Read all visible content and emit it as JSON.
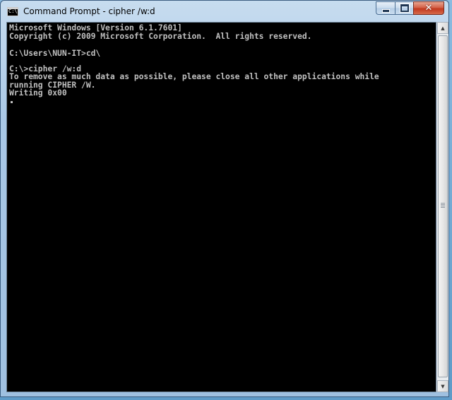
{
  "window": {
    "title": "Command Prompt - cipher  /w:d",
    "icon": "command-prompt-icon",
    "icon_text": "C:\\"
  },
  "controls": {
    "minimize": "minimize-icon",
    "maximize": "maximize-icon",
    "close": "close-icon",
    "close_glyph": "✕"
  },
  "console": {
    "lines": [
      "Microsoft Windows [Version 6.1.7601]",
      "Copyright (c) 2009 Microsoft Corporation.  All rights reserved.",
      "",
      "C:\\Users\\NUN-IT>cd\\",
      "",
      "C:\\>cipher /w:d",
      "To remove as much data as possible, please close all other applications while",
      "running CIPHER /W.",
      "Writing 0x00"
    ],
    "text_color": "#c0c0c0",
    "background": "#000000"
  },
  "scrollbar": {
    "up_glyph": "▲",
    "down_glyph": "▼"
  }
}
